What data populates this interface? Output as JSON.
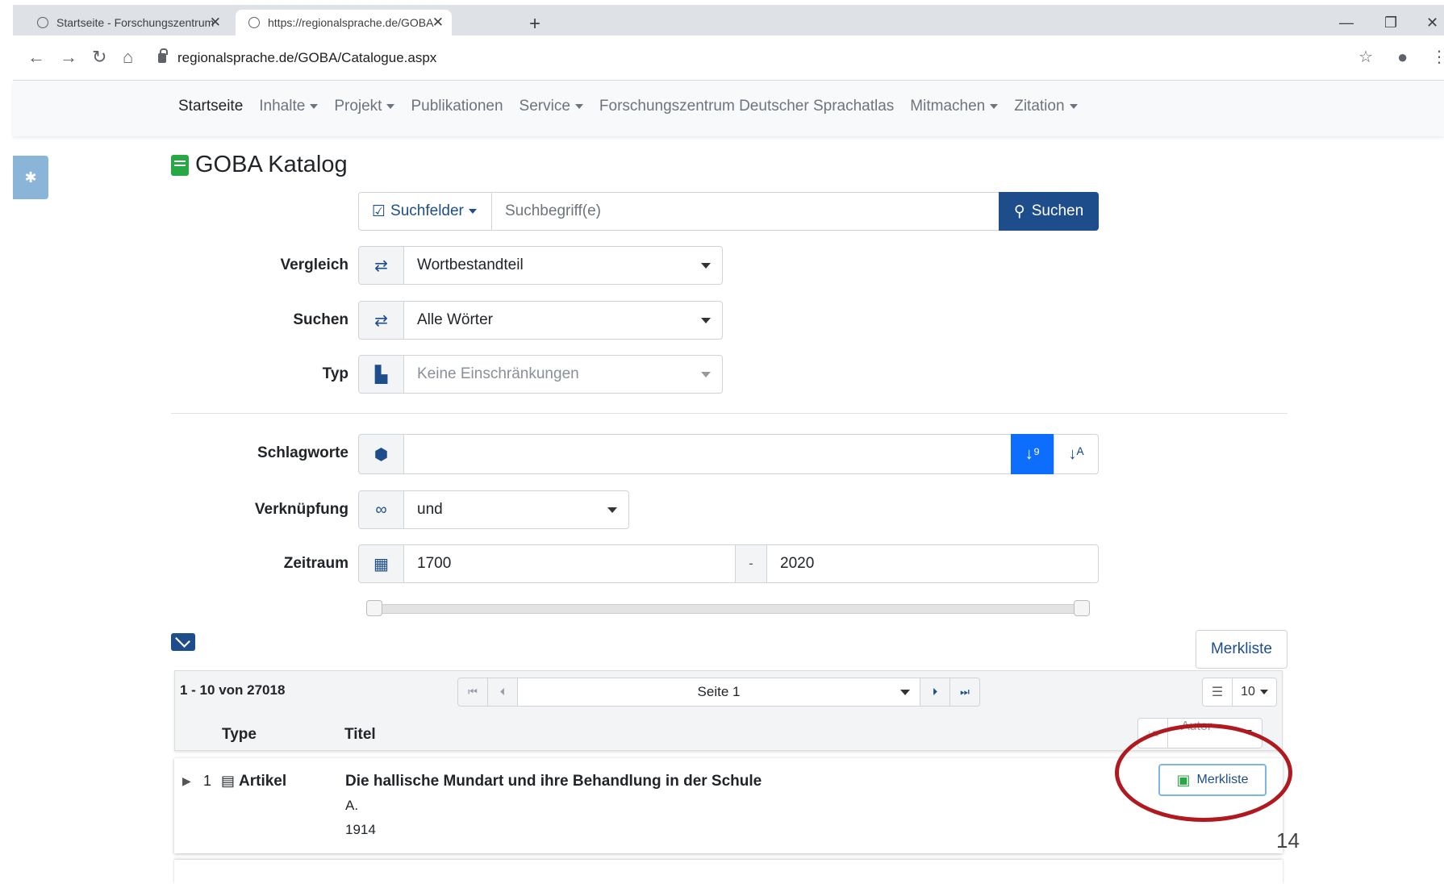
{
  "browser": {
    "tabs": [
      {
        "title": "Startseite - Forschungszentrum D"
      },
      {
        "title": "https://regionalsprache.de/GOBA"
      }
    ],
    "new_tab": "+",
    "url": "regionalsprache.de/GOBA/Catalogue.aspx"
  },
  "nav": {
    "items": [
      {
        "label": "Startseite",
        "dropdown": false
      },
      {
        "label": "Inhalte",
        "dropdown": true
      },
      {
        "label": "Projekt",
        "dropdown": true
      },
      {
        "label": "Publikationen",
        "dropdown": false
      },
      {
        "label": "Service",
        "dropdown": true
      },
      {
        "label": "Forschungszentrum Deutscher Sprachatlas",
        "dropdown": false
      },
      {
        "label": "Mitmachen",
        "dropdown": true
      },
      {
        "label": "Zitation",
        "dropdown": true
      }
    ]
  },
  "page": {
    "title": "GOBA Katalog"
  },
  "search": {
    "fields_button": "Suchfelder",
    "placeholder": "Suchbegriff(e)",
    "submit": "Suchen"
  },
  "filters": {
    "vergleich": {
      "label": "Vergleich",
      "value": "Wortbestandteil"
    },
    "suchen": {
      "label": "Suchen",
      "value": "Alle Wörter"
    },
    "typ": {
      "label": "Typ",
      "placeholder": "Keine Einschränkungen"
    },
    "schlagworte": {
      "label": "Schlagworte",
      "value": ""
    },
    "verknuepfung": {
      "label": "Verknüpfung",
      "value": "und"
    },
    "zeitraum": {
      "label": "Zeitraum",
      "from": "1700",
      "separator": "-",
      "to": "2020"
    }
  },
  "results": {
    "merkliste_button": "Merkliste",
    "range": "1 - 10 von 27018",
    "page_select": "Seite 1",
    "page_size": "10",
    "sort": "Autor",
    "columns": {
      "type": "Type",
      "title": "Titel"
    },
    "items": [
      {
        "index": "1",
        "type": "Artikel",
        "title": "Die hallische Mundart und ihre Behandlung in der Schule",
        "author": "A.",
        "year": "1914",
        "action": "Merkliste"
      }
    ]
  },
  "slide_number": "14",
  "colors": {
    "primary": "#1e4d8c",
    "active_sort": "#0d6efd",
    "annotation": "#b0191f",
    "brand_green": "#28a745"
  }
}
